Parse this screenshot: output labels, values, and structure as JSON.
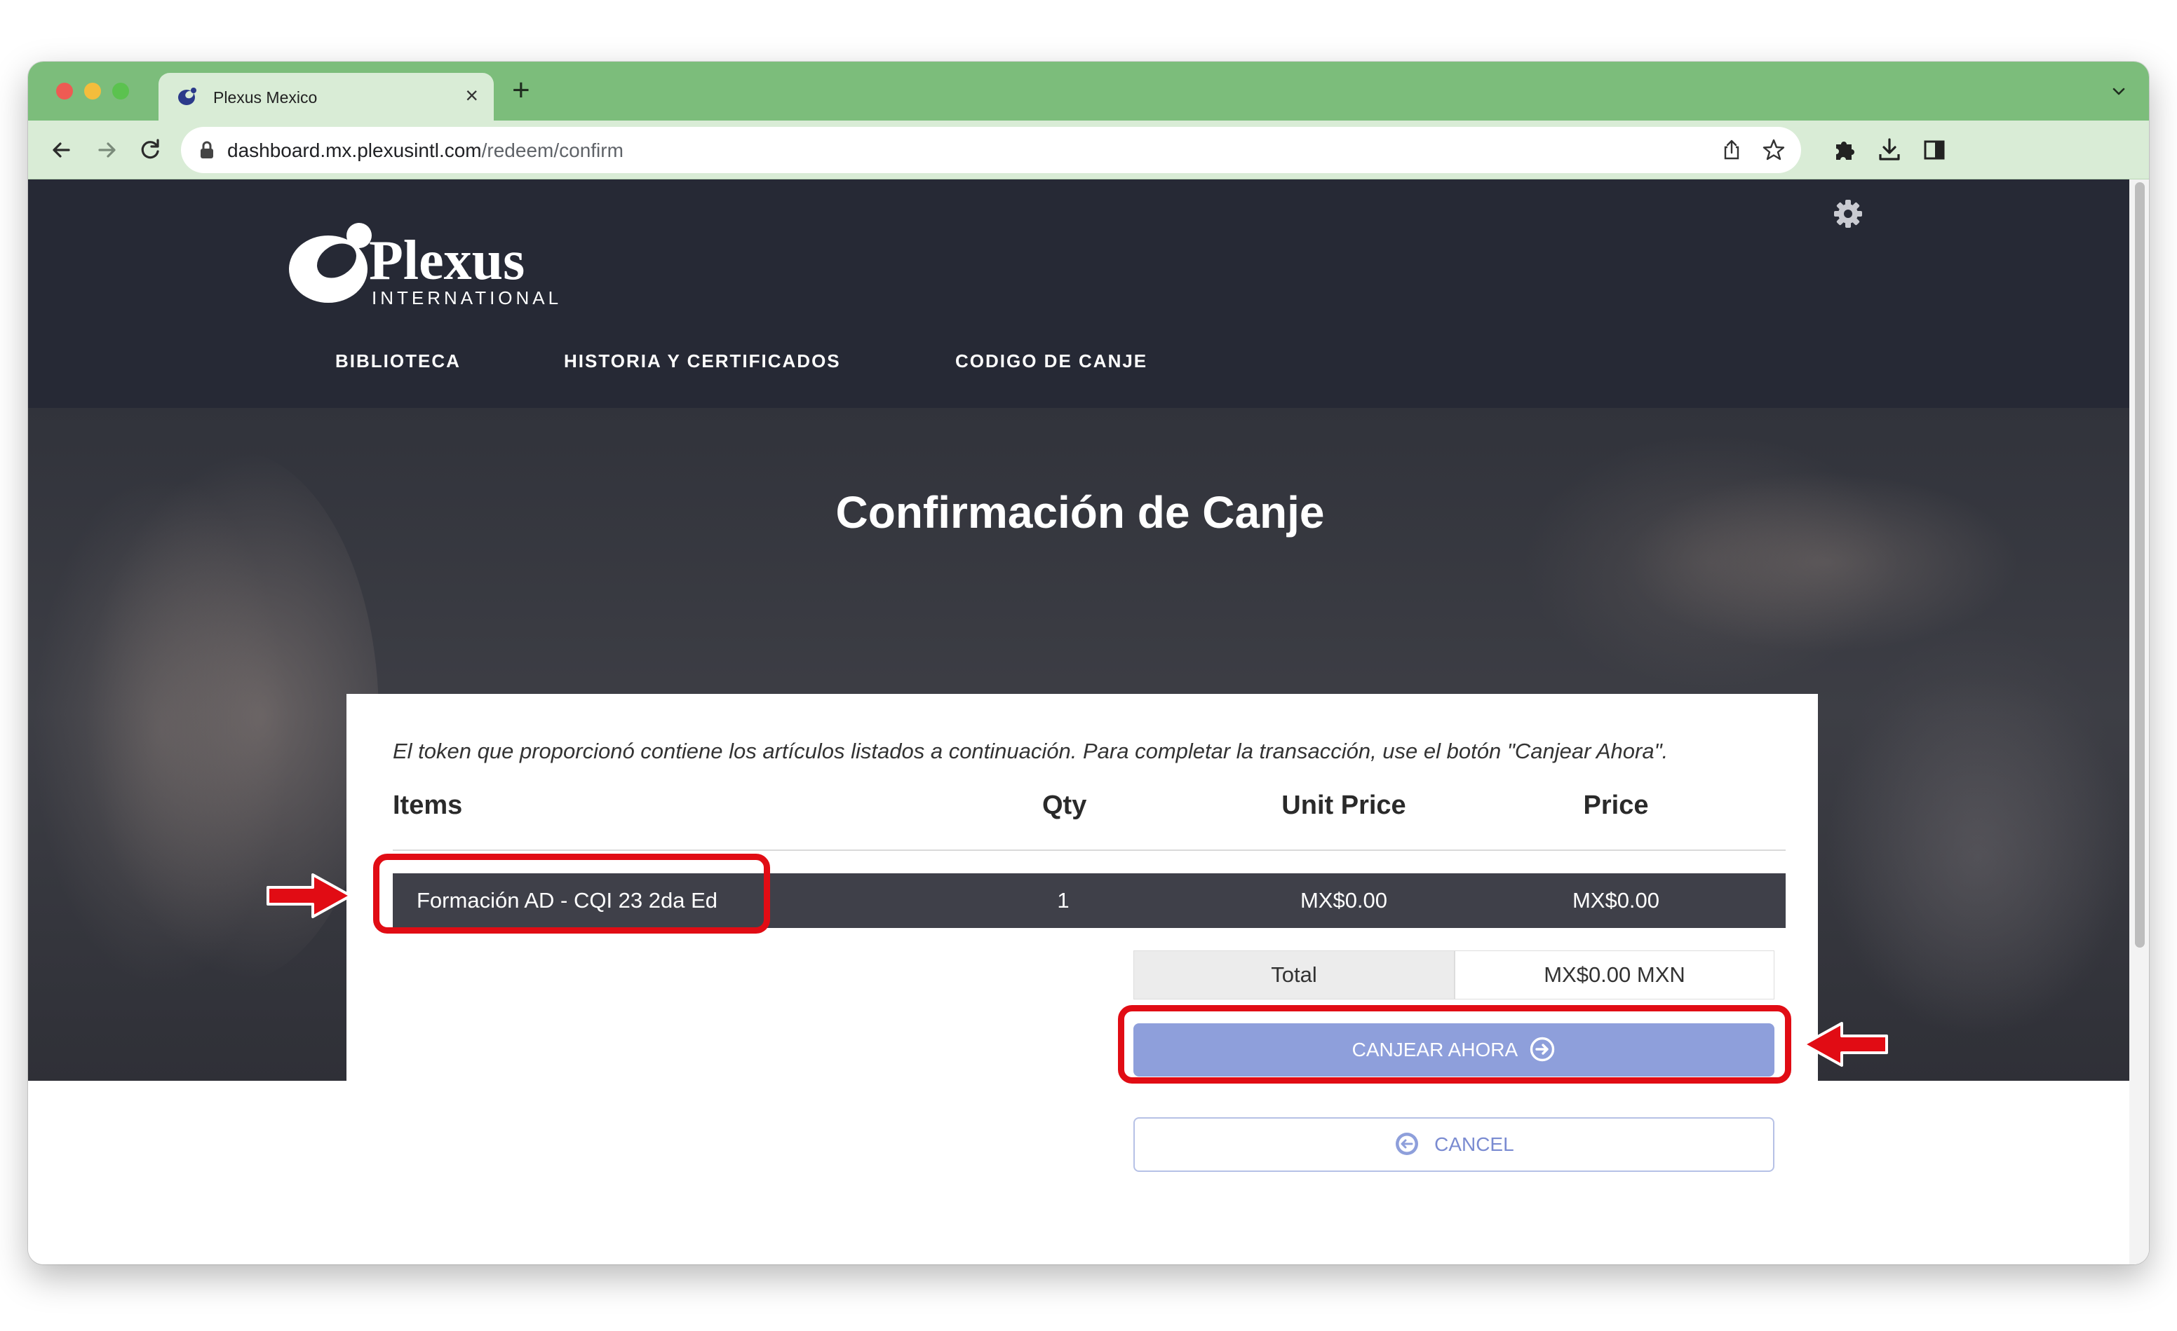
{
  "browser": {
    "tab_title": "Plexus Mexico",
    "url_host": "dashboard.mx.plexusintl.com",
    "url_path": "/redeem/confirm"
  },
  "site": {
    "logo_text": "Plexus",
    "logo_subtext": "INTERNATIONAL",
    "nav": [
      "BIBLIOTECA",
      "HISTORIA Y CERTIFICADOS",
      "CODIGO DE CANJE"
    ]
  },
  "page": {
    "title": "Confirmación de Canje",
    "intro": "El token que proporcionó contiene los artículos listados a continuación. Para completar la transacción, use el botón \"Canjear Ahora\"."
  },
  "table": {
    "headers": {
      "items": "Items",
      "qty": "Qty",
      "unit_price": "Unit Price",
      "price": "Price"
    },
    "rows": [
      {
        "item": "Formación AD - CQI 23 2da Ed",
        "qty": "1",
        "unit_price": "MX$0.00",
        "price": "MX$0.00"
      }
    ],
    "total_label": "Total",
    "total_value": "MX$0.00 MXN"
  },
  "actions": {
    "redeem_label": "CANJEAR AHORA",
    "cancel_label": "CANCEL"
  },
  "colors": {
    "tab_strip": "#7cbd7b",
    "header_bg": "#262935",
    "row_bg": "#3f4049",
    "redeem_btn": "#8e9fdb",
    "cancel_text": "#7a8bd1",
    "annotation": "#e10c14"
  },
  "icons": [
    "plexus-favicon-icon",
    "close-icon",
    "plus-icon",
    "chevron-down-icon",
    "back-arrow-icon",
    "forward-arrow-icon",
    "reload-icon",
    "lock-icon",
    "share-icon",
    "star-icon",
    "puzzle-icon",
    "download-icon",
    "sidebar-icon",
    "gear-icon",
    "arrow-right-circle-icon",
    "arrow-left-circle-icon"
  ]
}
